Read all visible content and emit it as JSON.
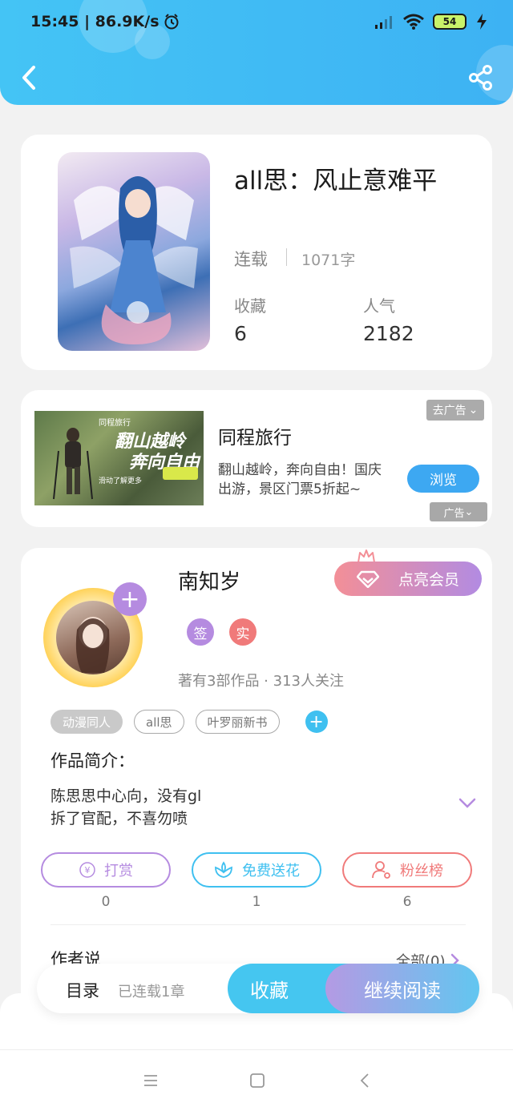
{
  "status_bar": {
    "time": "15:45 | 86.9K/s",
    "battery": "54"
  },
  "book": {
    "title": "all思：风止意难平",
    "status": "连载",
    "word_count": "1071字",
    "favorites_label": "收藏",
    "favorites_value": "6",
    "popularity_label": "人气",
    "popularity_value": "2182"
  },
  "ad": {
    "title": "同程旅行",
    "description": "翻山越岭，奔向自由！国庆出游，景区门票5折起~",
    "remove_label": "去广告",
    "browse_label": "浏览",
    "tag_label": "广告",
    "image_brand": "同程旅行",
    "image_slogan_1": "翻山越岭",
    "image_slogan_2": "奔向自由",
    "image_sub": "滑动了解更多"
  },
  "author": {
    "name": "南知岁",
    "vip_label": "点亮会员",
    "badge_sign": "签",
    "badge_real": "实",
    "meta": "著有3部作品 · 313人关注",
    "tags": [
      "动漫同人",
      "all思",
      "叶罗丽新书"
    ],
    "intro_label": "作品简介：",
    "intro_line1": "陈思思中心向，没有gl",
    "intro_line2": "拆了官配，不喜勿喷",
    "actions": [
      {
        "label": "打赏",
        "count": "0"
      },
      {
        "label": "免费送花",
        "count": "1"
      },
      {
        "label": "粉丝榜",
        "count": "6"
      }
    ],
    "author_says_label": "作者说",
    "all_label": "全部(0)"
  },
  "bottom_bar": {
    "toc_label": "目录",
    "chapter_count": "已连载1章",
    "collect_label": "收藏",
    "continue_label": "继续阅读"
  },
  "colors": {
    "header": "#44c4f5",
    "purple": "#b58be0",
    "pink": "#f38f97",
    "cyan": "#3fc0f0"
  }
}
